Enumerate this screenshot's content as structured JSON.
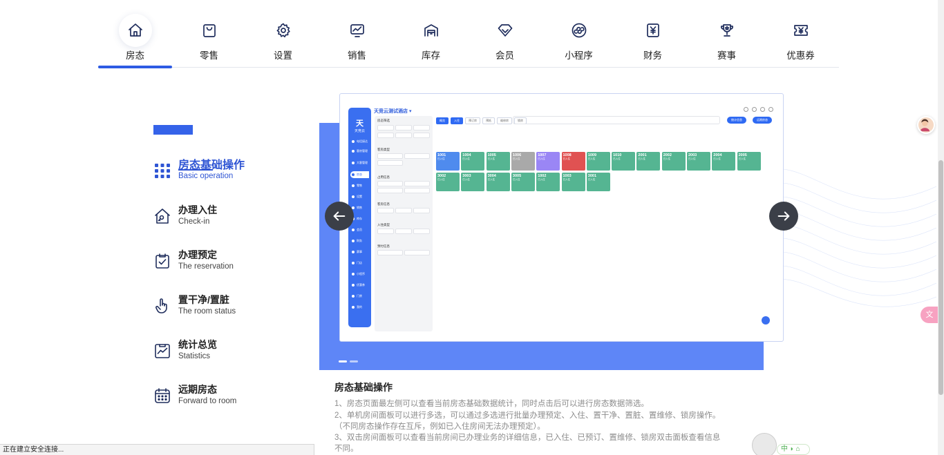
{
  "nav": [
    {
      "label": "房态",
      "icon": "home-icon",
      "active": true
    },
    {
      "label": "零售",
      "icon": "shopping-bag-icon"
    },
    {
      "label": "设置",
      "icon": "gear-icon"
    },
    {
      "label": "销售",
      "icon": "sales-chart-icon"
    },
    {
      "label": "库存",
      "icon": "warehouse-icon"
    },
    {
      "label": "会员",
      "icon": "diamond-icon"
    },
    {
      "label": "小程序",
      "icon": "mini-program-icon"
    },
    {
      "label": "财务",
      "icon": "finance-yen-icon"
    },
    {
      "label": "赛事",
      "icon": "trophy-icon"
    },
    {
      "label": "优惠券",
      "icon": "coupon-icon"
    }
  ],
  "features": [
    {
      "title": "房态基础操作",
      "subtitle": "Basic operation",
      "icon": "grid-icon",
      "active": true
    },
    {
      "title": "办理入住",
      "subtitle": "Check-in",
      "icon": "house-key-icon"
    },
    {
      "title": "办理预定",
      "subtitle": "The reservation",
      "icon": "clipboard-check-icon"
    },
    {
      "title": "置干净/置脏",
      "subtitle": "The room status",
      "icon": "hand-pointer-icon"
    },
    {
      "title": "统计总览",
      "subtitle": "Statistics",
      "icon": "stats-chart-icon"
    },
    {
      "title": "远期房态",
      "subtitle": "Forward to room",
      "icon": "calendar-icon"
    }
  ],
  "preview": {
    "app_title": "天竞云测试酒店 ▾",
    "logo_text": "天竞云",
    "menu": [
      "电话接达",
      "客房管理",
      "大客管理",
      "房态",
      "零售",
      "设置",
      "销售",
      "库存",
      "会员",
      "财务",
      "赛事",
      "门店",
      "小程序",
      "优惠券",
      "门禁",
      "我的"
    ],
    "filter_sections": [
      "房态筛选",
      "客房类型",
      "占用信息",
      "客房信息",
      "入住类型",
      "预付信息"
    ],
    "tabs": [
      "概览",
      "入住",
      "预订房",
      "预抵",
      "维修房",
      "锁房"
    ],
    "buttons": [
      "统计信息",
      "远期房态"
    ],
    "rooms_row1": [
      {
        "num": "1001",
        "status": "已入住",
        "color": "b"
      },
      {
        "num": "1004",
        "status": "已入住",
        "color": "g"
      },
      {
        "num": "1005",
        "status": "已入住",
        "color": "g"
      },
      {
        "num": "1006",
        "status": "已入住",
        "color": "gy"
      },
      {
        "num": "1007",
        "status": "已入住",
        "color": "p"
      },
      {
        "num": "1008",
        "status": "已入住",
        "color": "r"
      },
      {
        "num": "1009",
        "status": "已入住",
        "color": "g"
      },
      {
        "num": "1010",
        "status": "已入住",
        "color": "g"
      },
      {
        "num": "2001",
        "status": "已入住",
        "color": "g"
      },
      {
        "num": "2002",
        "status": "已入住",
        "color": "g"
      },
      {
        "num": "2003",
        "status": "已入住",
        "color": "g"
      },
      {
        "num": "2004",
        "status": "已入住",
        "color": "g"
      },
      {
        "num": "2005",
        "status": "已入住",
        "color": "g"
      }
    ],
    "rooms_row2": [
      {
        "num": "3002",
        "status": "已入住",
        "color": "g"
      },
      {
        "num": "3003",
        "status": "已入住",
        "color": "g"
      },
      {
        "num": "3004",
        "status": "已入住",
        "color": "g"
      },
      {
        "num": "3005",
        "status": "已入住",
        "color": "g"
      },
      {
        "num": "1002",
        "status": "已入住",
        "color": "g"
      },
      {
        "num": "1003",
        "status": "已入住",
        "color": "g"
      },
      {
        "num": "3001",
        "status": "已入住",
        "color": "g"
      }
    ]
  },
  "description": {
    "title": "房态基础操作",
    "lines": [
      "1、房态页面最左侧可以查看当前房态基础数据统计，同时点击后可以进行房态数据筛选。",
      "2、单机房间面板可以进行多选，可以通过多选进行批量办理预定、入住、置干净、置脏、置维修、锁房操作。",
      "（不同房态操作存在互斥，例如已入住房间无法办理预定）。",
      "3、双击房间面板可以查看当前房间已办理业务的详细信息，已入住、已预订、置维修、锁房双击面板查看信息",
      "不同。"
    ]
  },
  "status_bar": "正在建立安全连接...",
  "ime_label": "中",
  "translate_label": "文",
  "colors": {
    "accent": "#2d5be3",
    "panel": "#5e86f7",
    "dark_arrow": "#3b3f48"
  }
}
